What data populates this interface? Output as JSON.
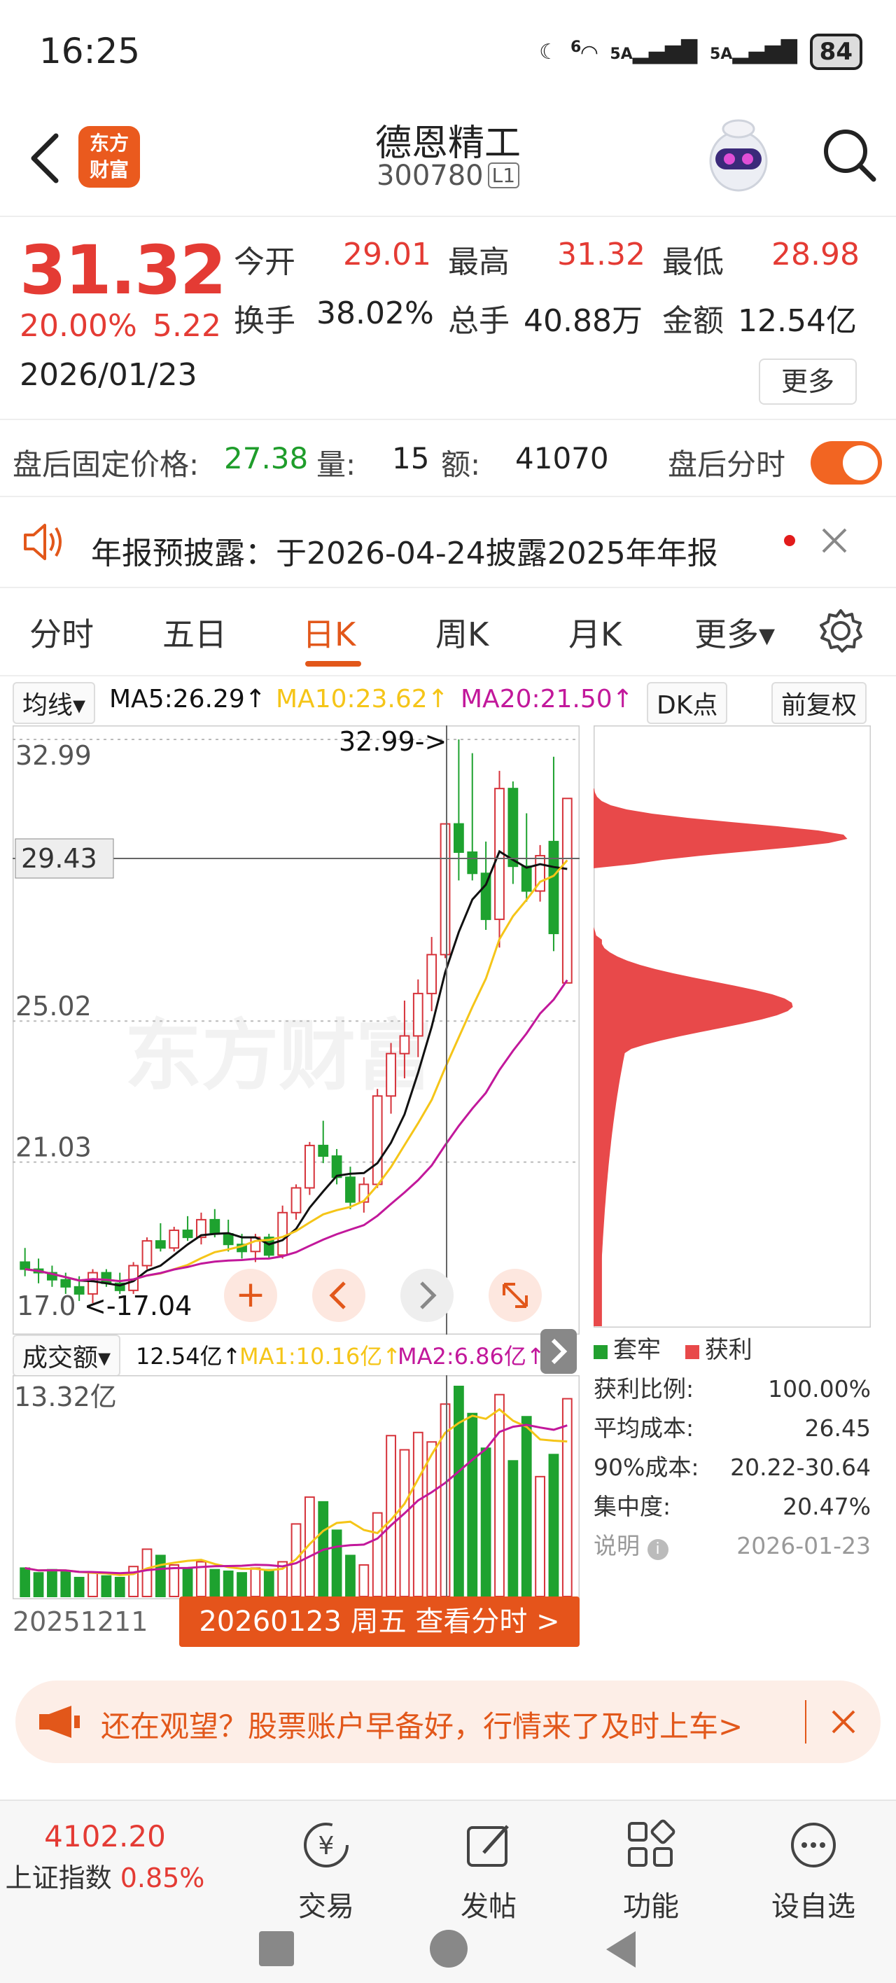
{
  "status_bar": {
    "time": "16:25",
    "signal1": "5A",
    "signal2": "5A",
    "wifi_badge": "6",
    "battery": "84"
  },
  "header": {
    "logo_line1": "东方",
    "logo_line2": "财富",
    "stock_name": "德恩精工",
    "stock_code": "300780",
    "code_tag": "L1"
  },
  "quote": {
    "price": "31.32",
    "change_pct": "20.00%",
    "change_val": "5.22",
    "date": "2026/01/23",
    "open_label": "今开",
    "open": "29.01",
    "high_label": "最高",
    "high": "31.32",
    "low_label": "最低",
    "low": "28.98",
    "turnover_label": "换手",
    "turnover": "38.02%",
    "volume_label": "总手",
    "volume": "40.88万",
    "amount_label": "金额",
    "amount": "12.54亿",
    "more_label": "更多"
  },
  "after_hours": {
    "price_label": "盘后固定价格:",
    "price": "27.38",
    "vol_label": "量:",
    "vol": "15",
    "amt_label": "额:",
    "amt": "41070",
    "toggle_label": "盘后分时"
  },
  "notice": {
    "text": "年报预披露：于2026-04-24披露2025年年报"
  },
  "tabs": [
    "分时",
    "五日",
    "日K",
    "周K",
    "月K",
    "更多▾"
  ],
  "ma": {
    "selector": "均线▾",
    "ma5": "MA5:26.29↑",
    "ma10": "MA10:23.62↑",
    "ma20": "MA20:21.50↑",
    "dk": "DK点",
    "adjust": "前复权",
    "colors": {
      "ma5": "#111111",
      "ma10": "#f5c518",
      "ma20": "#c2189b"
    }
  },
  "kline": {
    "y_ticks": [
      "32.99",
      "25.02",
      "21.03"
    ],
    "crosshair_price": "29.43",
    "max_note": "32.99->",
    "min_note": "<-17.04",
    "min_label": "17.0",
    "watermark": "东方财富"
  },
  "volume": {
    "selector": "成交额▾",
    "value": "12.54亿↑",
    "ma1": "MA1:10.16亿↑",
    "ma2": "MA2:6.86亿↑",
    "max_label": "13.32亿",
    "start_date": "20251211"
  },
  "date_banner": "20260123 周五 查看分时 >",
  "chip": {
    "legend_trapped": "套牢",
    "legend_profit": "获利",
    "rows": [
      {
        "label": "获利比例:",
        "value": "100.00%"
      },
      {
        "label": "平均成本:",
        "value": "26.45"
      },
      {
        "label": "90%成本:",
        "value": "20.22-30.64"
      },
      {
        "label": "集中度:",
        "value": "20.47%"
      }
    ],
    "note_label": "说明",
    "note_date": "2026-01-23"
  },
  "chart_data": {
    "type": "candlestick",
    "ylim": [
      17.04,
      32.99
    ],
    "candles": [
      {
        "o": 18.2,
        "h": 18.6,
        "l": 17.8,
        "c": 18.0
      },
      {
        "o": 18.0,
        "h": 18.3,
        "l": 17.6,
        "c": 17.9
      },
      {
        "o": 17.9,
        "h": 18.1,
        "l": 17.5,
        "c": 17.7
      },
      {
        "o": 17.7,
        "h": 17.9,
        "l": 17.3,
        "c": 17.5
      },
      {
        "o": 17.5,
        "h": 17.8,
        "l": 17.1,
        "c": 17.3
      },
      {
        "o": 17.3,
        "h": 18.0,
        "l": 17.04,
        "c": 17.9
      },
      {
        "o": 17.9,
        "h": 18.0,
        "l": 17.5,
        "c": 17.6
      },
      {
        "o": 17.6,
        "h": 17.9,
        "l": 17.3,
        "c": 17.4
      },
      {
        "o": 17.4,
        "h": 18.2,
        "l": 17.3,
        "c": 18.1
      },
      {
        "o": 18.1,
        "h": 18.9,
        "l": 18.0,
        "c": 18.8
      },
      {
        "o": 18.8,
        "h": 19.3,
        "l": 18.5,
        "c": 18.6
      },
      {
        "o": 18.6,
        "h": 19.2,
        "l": 18.5,
        "c": 19.1
      },
      {
        "o": 19.1,
        "h": 19.5,
        "l": 18.8,
        "c": 18.9
      },
      {
        "o": 18.9,
        "h": 19.6,
        "l": 18.7,
        "c": 19.4
      },
      {
        "o": 19.4,
        "h": 19.7,
        "l": 18.9,
        "c": 19.0
      },
      {
        "o": 19.0,
        "h": 19.4,
        "l": 18.5,
        "c": 18.7
      },
      {
        "o": 18.7,
        "h": 19.0,
        "l": 18.3,
        "c": 18.5
      },
      {
        "o": 18.5,
        "h": 19.0,
        "l": 18.2,
        "c": 18.9
      },
      {
        "o": 18.9,
        "h": 19.0,
        "l": 18.3,
        "c": 18.4
      },
      {
        "o": 18.4,
        "h": 19.8,
        "l": 18.3,
        "c": 19.6
      },
      {
        "o": 19.6,
        "h": 20.4,
        "l": 19.4,
        "c": 20.3
      },
      {
        "o": 20.3,
        "h": 21.6,
        "l": 20.1,
        "c": 21.5
      },
      {
        "o": 21.5,
        "h": 22.2,
        "l": 21.0,
        "c": 21.2
      },
      {
        "o": 21.2,
        "h": 21.4,
        "l": 20.4,
        "c": 20.6
      },
      {
        "o": 20.6,
        "h": 20.9,
        "l": 19.7,
        "c": 19.9
      },
      {
        "o": 19.9,
        "h": 20.6,
        "l": 19.6,
        "c": 20.4
      },
      {
        "o": 20.4,
        "h": 23.1,
        "l": 20.3,
        "c": 22.9
      },
      {
        "o": 22.9,
        "h": 24.4,
        "l": 22.4,
        "c": 24.1
      },
      {
        "o": 24.1,
        "h": 25.6,
        "l": 23.4,
        "c": 24.6
      },
      {
        "o": 24.6,
        "h": 26.2,
        "l": 24.0,
        "c": 25.8
      },
      {
        "o": 25.8,
        "h": 27.4,
        "l": 25.3,
        "c": 26.9
      },
      {
        "o": 26.9,
        "h": 30.6,
        "l": 26.8,
        "c": 30.6
      },
      {
        "o": 30.6,
        "h": 32.99,
        "l": 29.0,
        "c": 29.8
      },
      {
        "o": 29.8,
        "h": 32.6,
        "l": 29.0,
        "c": 29.2
      },
      {
        "o": 29.2,
        "h": 30.1,
        "l": 27.6,
        "c": 27.9
      },
      {
        "o": 27.9,
        "h": 32.1,
        "l": 27.1,
        "c": 31.6
      },
      {
        "o": 31.6,
        "h": 31.8,
        "l": 28.9,
        "c": 29.4
      },
      {
        "o": 29.4,
        "h": 30.9,
        "l": 28.4,
        "c": 28.7
      },
      {
        "o": 28.7,
        "h": 30.0,
        "l": 28.4,
        "c": 29.7
      },
      {
        "o": 30.1,
        "h": 32.5,
        "l": 27.0,
        "c": 27.5
      },
      {
        "o": 26.1,
        "h": 31.32,
        "l": 28.98,
        "c": 31.32
      }
    ],
    "amount_yi": [
      1.8,
      1.5,
      1.7,
      1.6,
      1.2,
      1.5,
      1.3,
      1.2,
      1.9,
      3.0,
      2.6,
      2.0,
      1.8,
      2.2,
      1.7,
      1.6,
      1.5,
      1.8,
      1.7,
      2.2,
      4.6,
      6.3,
      6.0,
      4.2,
      2.6,
      2.0,
      5.3,
      10.2,
      9.3,
      10.4,
      9.8,
      12.2,
      13.32,
      11.6,
      9.4,
      12.8,
      8.6,
      11.4,
      7.6,
      9.0,
      12.54
    ]
  }
}
